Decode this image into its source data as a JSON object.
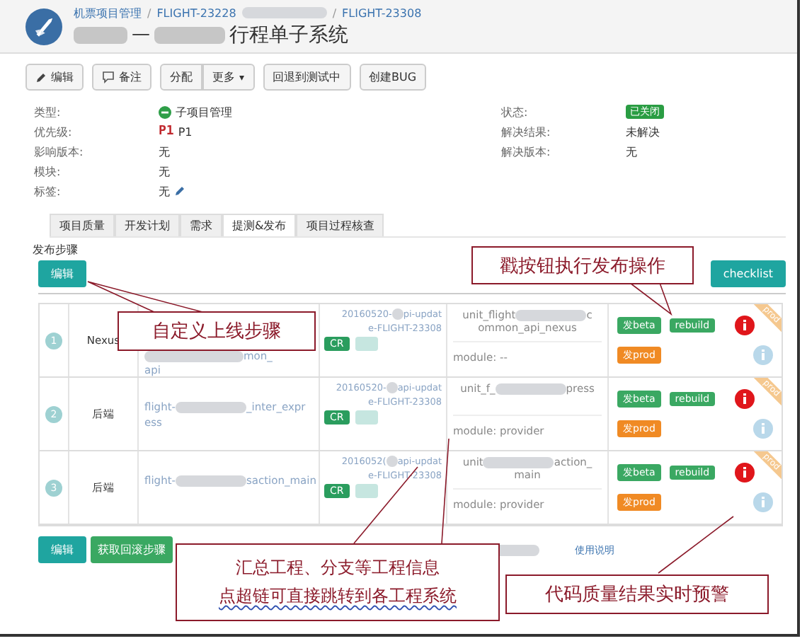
{
  "breadcrumbs": [
    "机票项目管理",
    "FLIGHT-23228",
    "FLIGHT-23308"
  ],
  "breadcrumb_separator": "/",
  "title_dash": "—",
  "title": "行程单子系统",
  "toolbar": [
    {
      "label": "编辑"
    },
    {
      "label": "备注"
    },
    {
      "label": "分配"
    },
    {
      "label": "更多",
      "caret": "▾"
    },
    {
      "label": "回退到测试中"
    },
    {
      "label": "创建BUG"
    }
  ],
  "fields_left": [
    {
      "label": "类型:",
      "value": "子项目管理",
      "kind": "type"
    },
    {
      "label": "优先级:",
      "value": "P1",
      "badge": "P1",
      "kind": "priority"
    },
    {
      "label": "影响版本:",
      "value": "无",
      "kind": "text"
    },
    {
      "label": "模块:",
      "value": "无",
      "kind": "text"
    },
    {
      "label": "标签:",
      "value": "无",
      "kind": "editable"
    }
  ],
  "fields_right": [
    {
      "label": "状态:",
      "value": "已关闭",
      "kind": "status"
    },
    {
      "label": "解决结果:",
      "value": "未解决",
      "kind": "text"
    },
    {
      "label": "解决版本:",
      "value": "无",
      "kind": "text"
    }
  ],
  "tabs": [
    {
      "label": "项目质量",
      "selected": false
    },
    {
      "label": "开发计划",
      "selected": false
    },
    {
      "label": "需求",
      "selected": false
    },
    {
      "label": "提测&发布",
      "selected": true
    },
    {
      "label": "项目过程核查",
      "selected": false
    }
  ],
  "section_label": "发布步骤",
  "edit_button": "编辑",
  "checklist_button": "checklist",
  "rows": [
    {
      "number": "1",
      "type": "Nexus",
      "project": [
        "mon_",
        "api"
      ],
      "branch": [
        "20160520-",
        "pi-updat",
        "e-FLIGHT-23308"
      ],
      "cr": "CR",
      "unit": [
        "unit_flight",
        "c",
        "ommon_api_nexus"
      ],
      "module": "module: --",
      "beta": "发beta",
      "rebuild": "rebuild",
      "prod": "发prod",
      "ribbon": "prod"
    },
    {
      "number": "2",
      "type": "后端",
      "project": [
        "flight-",
        "_inter_expr",
        "ess"
      ],
      "branch": [
        "20160520-",
        "api-updat",
        "e-FLIGHT-23308"
      ],
      "cr": "CR",
      "unit": [
        "unit_f_",
        "press"
      ],
      "module": "module: provider",
      "beta": "发beta",
      "rebuild": "rebuild",
      "prod": "发prod",
      "ribbon": "prod"
    },
    {
      "number": "3",
      "type": "后端",
      "project": [
        "flight-",
        "saction_main"
      ],
      "branch": [
        "2016052(",
        "api-updat",
        "e-FLIGHT-23308"
      ],
      "cr": "CR",
      "unit": [
        "unit",
        "action_",
        "main"
      ],
      "module": "module: provider",
      "beta": "发beta",
      "rebuild": "rebuild",
      "prod": "发prod",
      "ribbon": "prod"
    }
  ],
  "footer": {
    "edit": "编辑",
    "rollback": "获取回滚步骤",
    "help": "使用说明"
  },
  "annotations": [
    "自定义上线步骤",
    "戳按钮执行发布操作",
    "汇总工程、分支等工程信息",
    "点超链可直接跳转到各工程系统",
    "代码质量结果实时预警"
  ]
}
